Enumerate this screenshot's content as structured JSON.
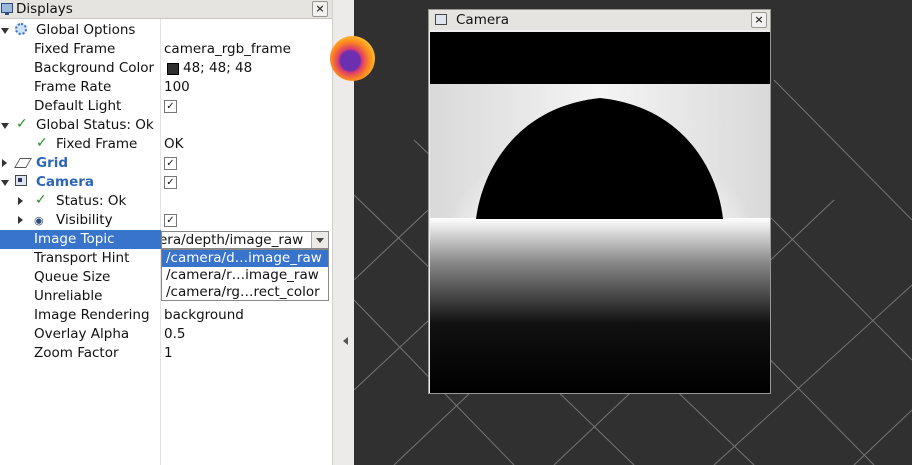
{
  "displays": {
    "title": "Displays",
    "close_label": "×",
    "rows": [
      {
        "name": "Global Options",
        "value": ""
      },
      {
        "name": "Fixed Frame",
        "value": "camera_rgb_frame"
      },
      {
        "name": "Background Color",
        "value": "48; 48; 48"
      },
      {
        "name": "Frame Rate",
        "value": "100"
      },
      {
        "name": "Default Light",
        "value": "✓"
      },
      {
        "name": "Global Status: Ok",
        "value": ""
      },
      {
        "name": "Fixed Frame",
        "value": "OK"
      },
      {
        "name": "Grid",
        "value": "✓"
      },
      {
        "name": "Camera",
        "value": "✓"
      },
      {
        "name": "Status: Ok",
        "value": ""
      },
      {
        "name": "Visibility",
        "value": "✓"
      },
      {
        "name": "Image Topic",
        "value": "era/depth/image_raw"
      },
      {
        "name": "Transport Hint",
        "value": ""
      },
      {
        "name": "Queue Size",
        "value": ""
      },
      {
        "name": "Unreliable",
        "value": ""
      },
      {
        "name": "Image Rendering",
        "value": "background"
      },
      {
        "name": "Overlay Alpha",
        "value": "0.5"
      },
      {
        "name": "Zoom Factor",
        "value": "1"
      }
    ],
    "topic_options": [
      "/camera/d…image_raw",
      "/camera/r…image_raw",
      "/camera/rg…rect_color"
    ],
    "background_color": "#303030"
  },
  "camera_window": {
    "title": "Camera",
    "close_label": "×"
  },
  "colors": {
    "selection": "#3874cc",
    "link_blue": "#2c66b8",
    "ok_green": "#2a8a2a"
  }
}
